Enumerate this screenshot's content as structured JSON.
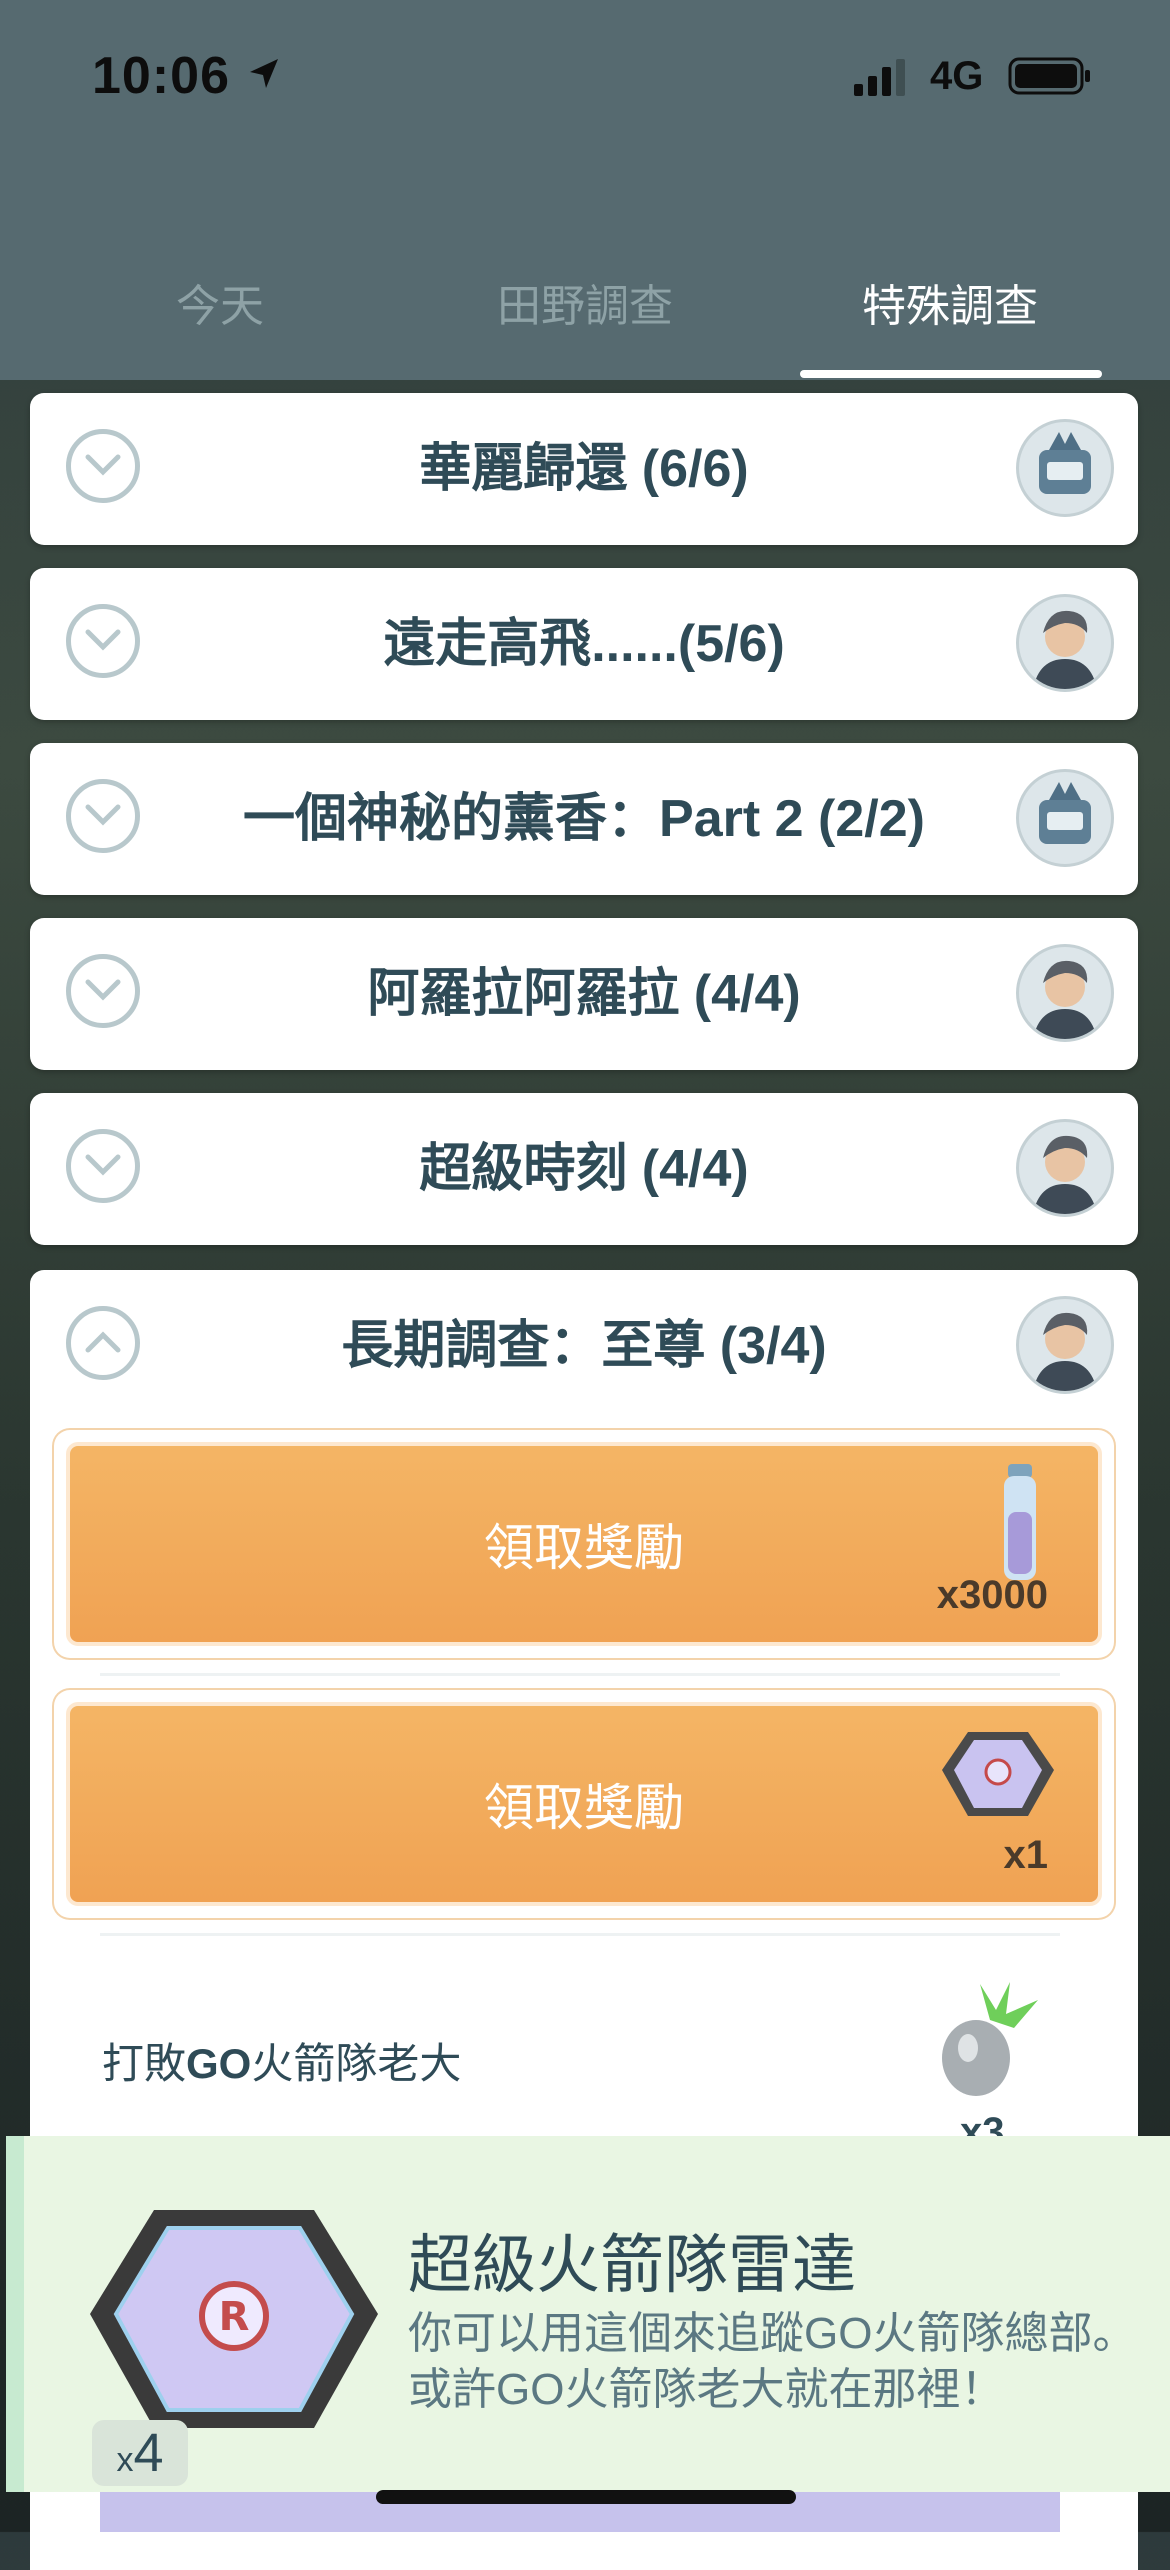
{
  "status": {
    "time": "10:06",
    "network": "4G"
  },
  "tabs": [
    {
      "label": "今天"
    },
    {
      "label": "田野調查"
    },
    {
      "label": "特殊調查"
    }
  ],
  "research": [
    {
      "title": "華麗歸還 (6/6)",
      "avatar": "robot-icon"
    },
    {
      "title": "遠走高飛......(5/6)",
      "avatar": "professor-icon"
    },
    {
      "title": "一個神秘的薰香：Part 2 (2/2)",
      "avatar": "robot-icon"
    },
    {
      "title": "阿羅拉阿羅拉 (4/4)",
      "avatar": "professor-icon"
    },
    {
      "title": "超級時刻 (4/4)",
      "avatar": "professor-icon"
    },
    {
      "title": "長期調查：至尊 (3/4)",
      "avatar": "professor-icon"
    }
  ],
  "rewards": [
    {
      "label": "領取獎勵",
      "count": "x3000",
      "icon": "stardust-vial-icon"
    },
    {
      "label": "領取獎勵",
      "count": "x1",
      "icon": "rocket-radar-icon"
    }
  ],
  "task": {
    "text_pre": "打敗",
    "text_bold": "GO",
    "text_post": "火箭隊老大",
    "count": "x3",
    "icon": "silver-pinap-berry-icon"
  },
  "toast": {
    "title": "超級火箭隊雷達",
    "description": "你可以用這個來追蹤GO火箭隊總部。或許GO火箭隊老大就在那裡！",
    "count_prefix": "x",
    "count": "4"
  }
}
